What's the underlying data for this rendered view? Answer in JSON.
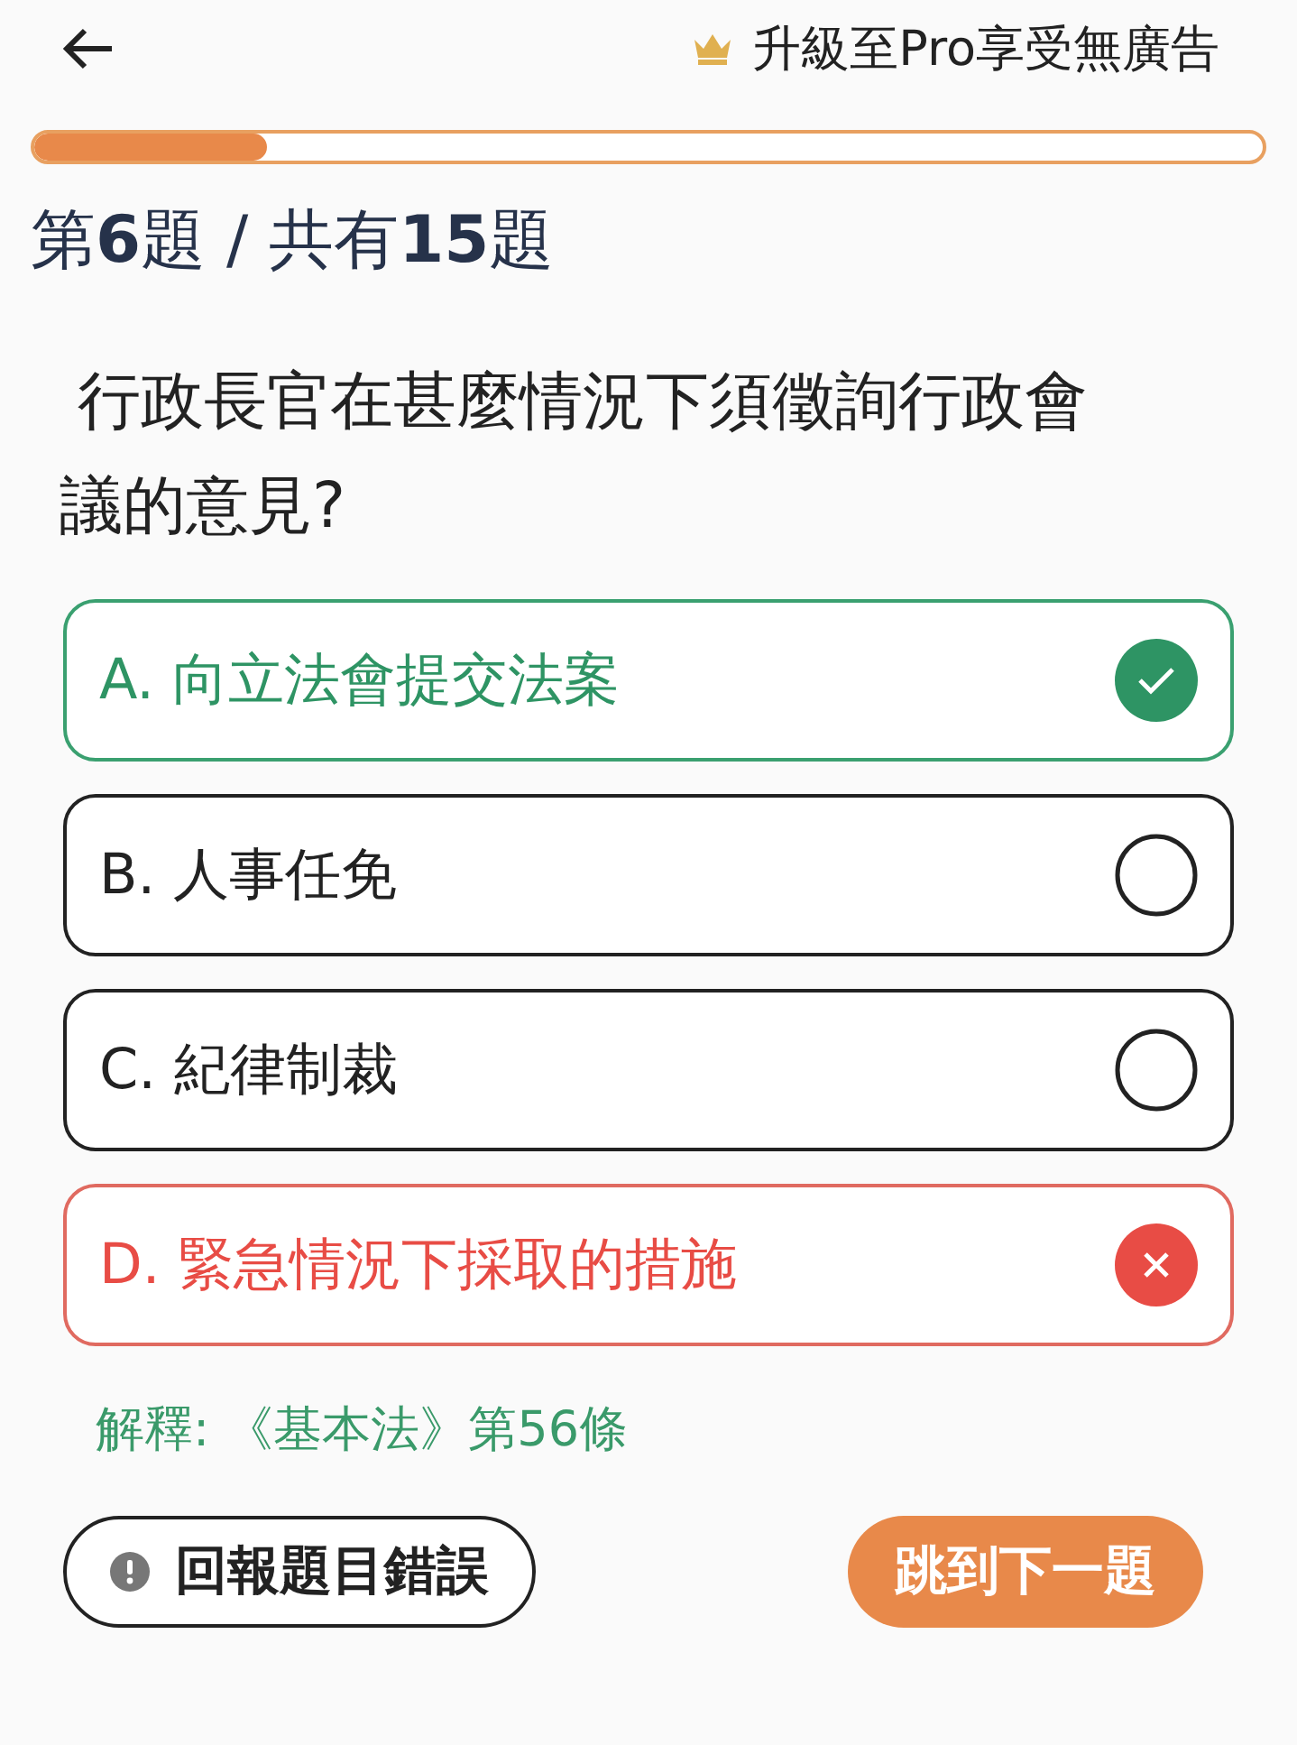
{
  "header": {
    "upgrade": "升級至Pro享受無廣告"
  },
  "progress": {
    "level": 0.19
  },
  "counter": "第**6**題 / 共有**15**題",
  "question": "行政長官在甚麼情況下須徵詢行政會議的意見?",
  "options": [
    {
      "label": "A. 向立法會提交法案",
      "correct": true,
      "wrong": false
    },
    {
      "label": "B. 人事任免",
      "correct": false,
      "wrong": false
    },
    {
      "label": "C. 紀律制裁",
      "correct": false,
      "wrong": false
    },
    {
      "label": "D. 緊急情況下採取的措施",
      "correct": false,
      "wrong": true
    }
  ],
  "explanation": "解釋: 《基本法》第56條",
  "buttons": {
    "report": "回報題目錯誤",
    "next": "跳到下一題"
  }
}
